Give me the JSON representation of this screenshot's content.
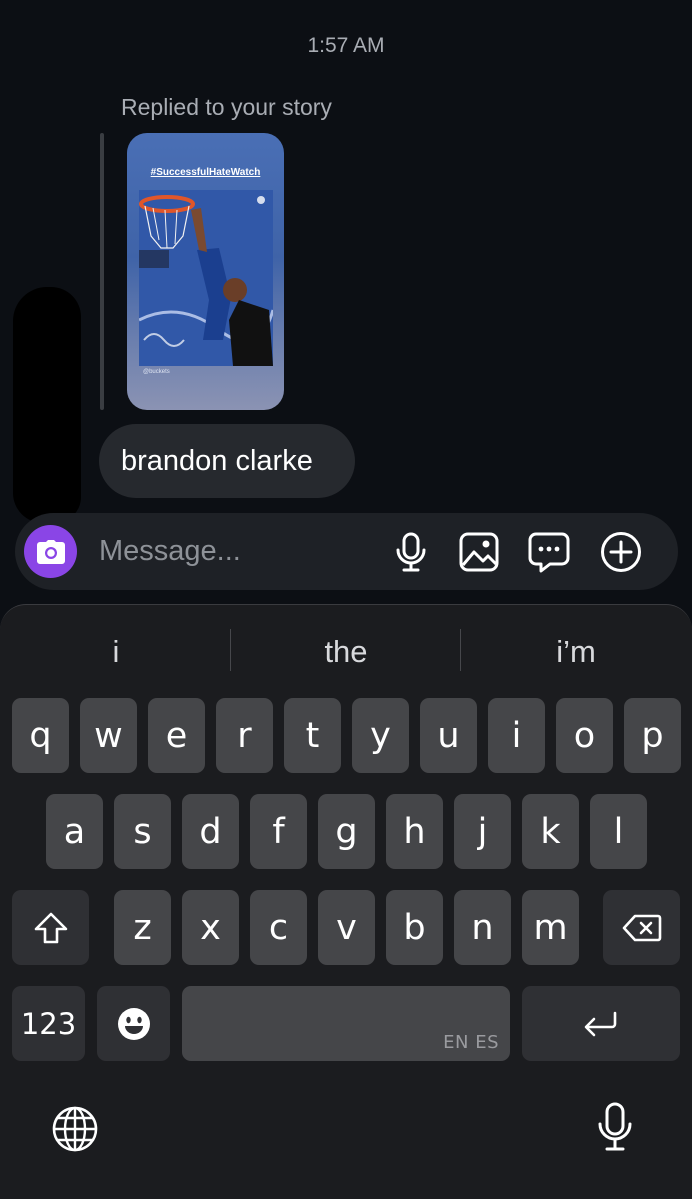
{
  "thread": {
    "timestamp": "1:57 AM",
    "reply_label": "Replied to your story",
    "story": {
      "hashtag": "#SuccessfulHateWatch",
      "credit": "@buckets"
    },
    "message": "brandon clarke"
  },
  "composer": {
    "placeholder": "Message...",
    "camera_icon": "camera-icon",
    "icons": [
      "microphone-icon",
      "image-icon",
      "sticker-chat-icon",
      "plus-circle-icon"
    ]
  },
  "keyboard": {
    "suggestions": [
      "i",
      "the",
      "i’m"
    ],
    "row1": [
      "q",
      "w",
      "e",
      "r",
      "t",
      "y",
      "u",
      "i",
      "o",
      "p"
    ],
    "row2": [
      "a",
      "s",
      "d",
      "f",
      "g",
      "h",
      "j",
      "k",
      "l"
    ],
    "row3": [
      "z",
      "x",
      "c",
      "v",
      "b",
      "n",
      "m"
    ],
    "numbers_label": "123",
    "space_lang": "EN ES",
    "colors": {
      "accent": "#8a45e6",
      "key": "#454649",
      "fn_key": "#2f3034"
    }
  }
}
